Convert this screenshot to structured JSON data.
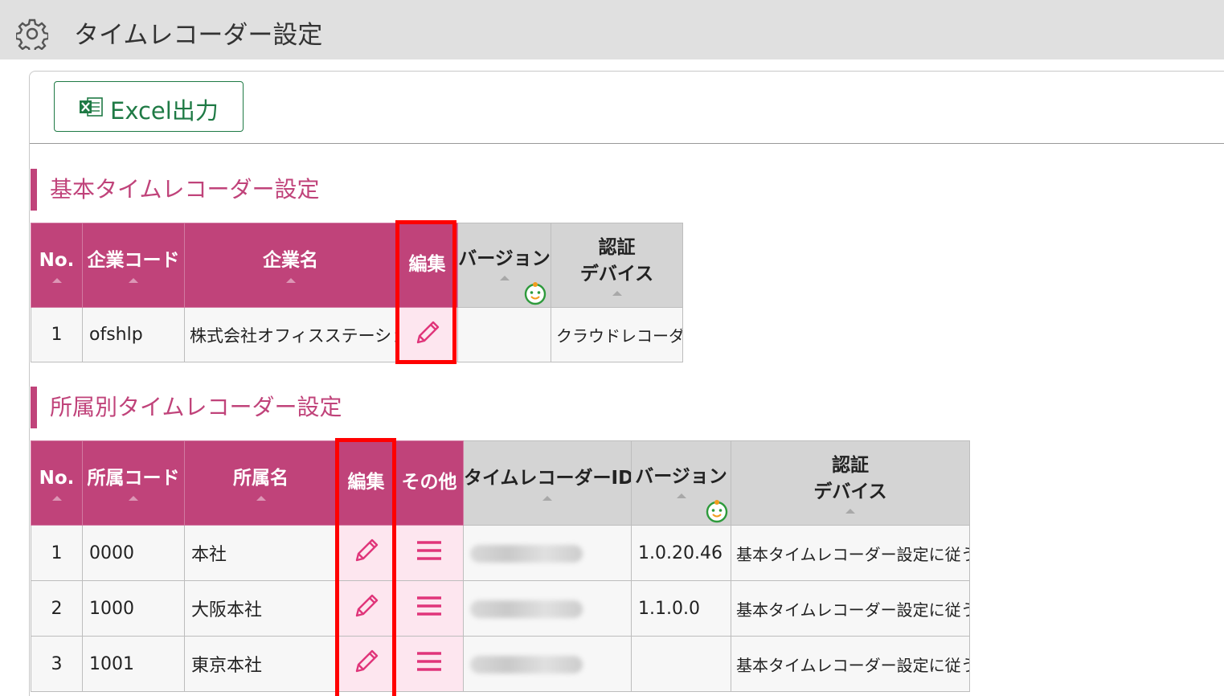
{
  "header": {
    "title": "タイムレコーダー設定",
    "icon": "gear-icon"
  },
  "toolbar": {
    "excel_label": "Excel出力",
    "excel_icon": "excel-icon"
  },
  "basic_section": {
    "title": "基本タイムレコーダー設定",
    "columns": [
      "No.",
      "企業コード",
      "企業名",
      "編集",
      "バージョン",
      "認証\nデバイス"
    ],
    "rows": [
      {
        "no": "1",
        "code": "ofshlp",
        "name": "株式会社オフィスステーション",
        "version": "",
        "device": "クラウドレコーダー"
      }
    ]
  },
  "dept_section": {
    "title": "所属別タイムレコーダー設定",
    "columns": [
      "No.",
      "所属コード",
      "所属名",
      "編集",
      "その他",
      "タイムレコーダーID",
      "バージョン",
      "認証\nデバイス"
    ],
    "rows": [
      {
        "no": "1",
        "code": "0000",
        "name": "本社",
        "version": "1.0.20.46",
        "device": "基本タイムレコーダー設定に従う"
      },
      {
        "no": "2",
        "code": "1000",
        "name": "大阪本社",
        "version": "1.1.0.0",
        "device": "基本タイムレコーダー設定に従う"
      },
      {
        "no": "3",
        "code": "1001",
        "name": "東京本社",
        "version": "",
        "device": "基本タイムレコーダー設定に従う"
      }
    ]
  },
  "colors": {
    "accent": "#c0437a",
    "header_gray": "#d4d4d4",
    "highlight_red": "#ff0000",
    "excel_green": "#1f7a45"
  }
}
